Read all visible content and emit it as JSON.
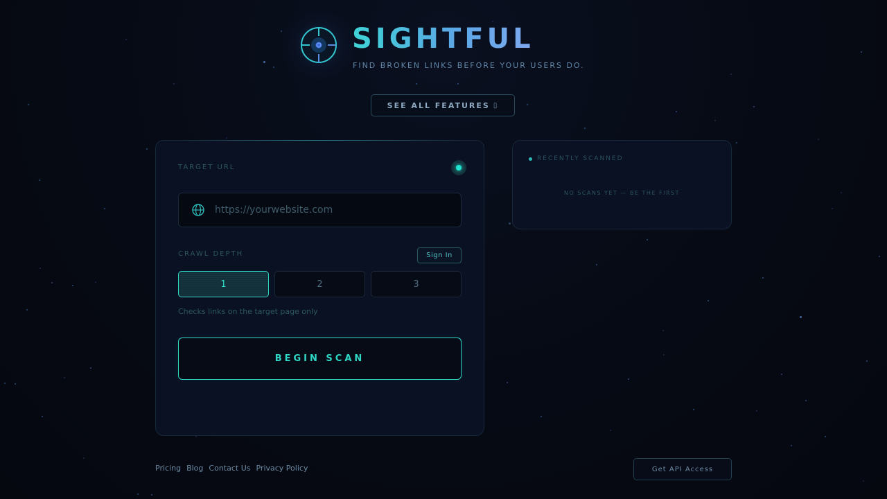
{
  "brand": {
    "title": "SIGHTFUL",
    "tagline": "FIND BROKEN LINKS BEFORE YOUR USERS DO.",
    "logo_icon": "crosshair-target-icon"
  },
  "header": {
    "features_label": "SEE ALL FEATURES",
    "features_arrow": "▯"
  },
  "scan_form": {
    "target_url_label": "TARGET URL",
    "url_placeholder": "https://yourwebsite.com",
    "url_value": "",
    "crawl_depth_label": "CRAWL DEPTH",
    "sign_in_label": "Sign In",
    "depth_options": [
      "1",
      "2",
      "3"
    ],
    "selected_depth": "1",
    "depth_hint": "Checks links on the target page only",
    "begin_scan_label": "BEGIN SCAN"
  },
  "recent": {
    "title": "RECENTLY SCANNED",
    "empty_message": "NO SCANS YET — BE THE FIRST"
  },
  "footer": {
    "links": [
      "Pricing",
      "Blog",
      "Contact Us",
      "Privacy Policy"
    ],
    "api_label": "Get API Access"
  },
  "colors": {
    "accent": "#2fd8c6",
    "background": "#060a14",
    "card": "#0a1122",
    "brand_gradient_start": "#3fd3d6",
    "brand_gradient_end": "#7fa8f0"
  }
}
